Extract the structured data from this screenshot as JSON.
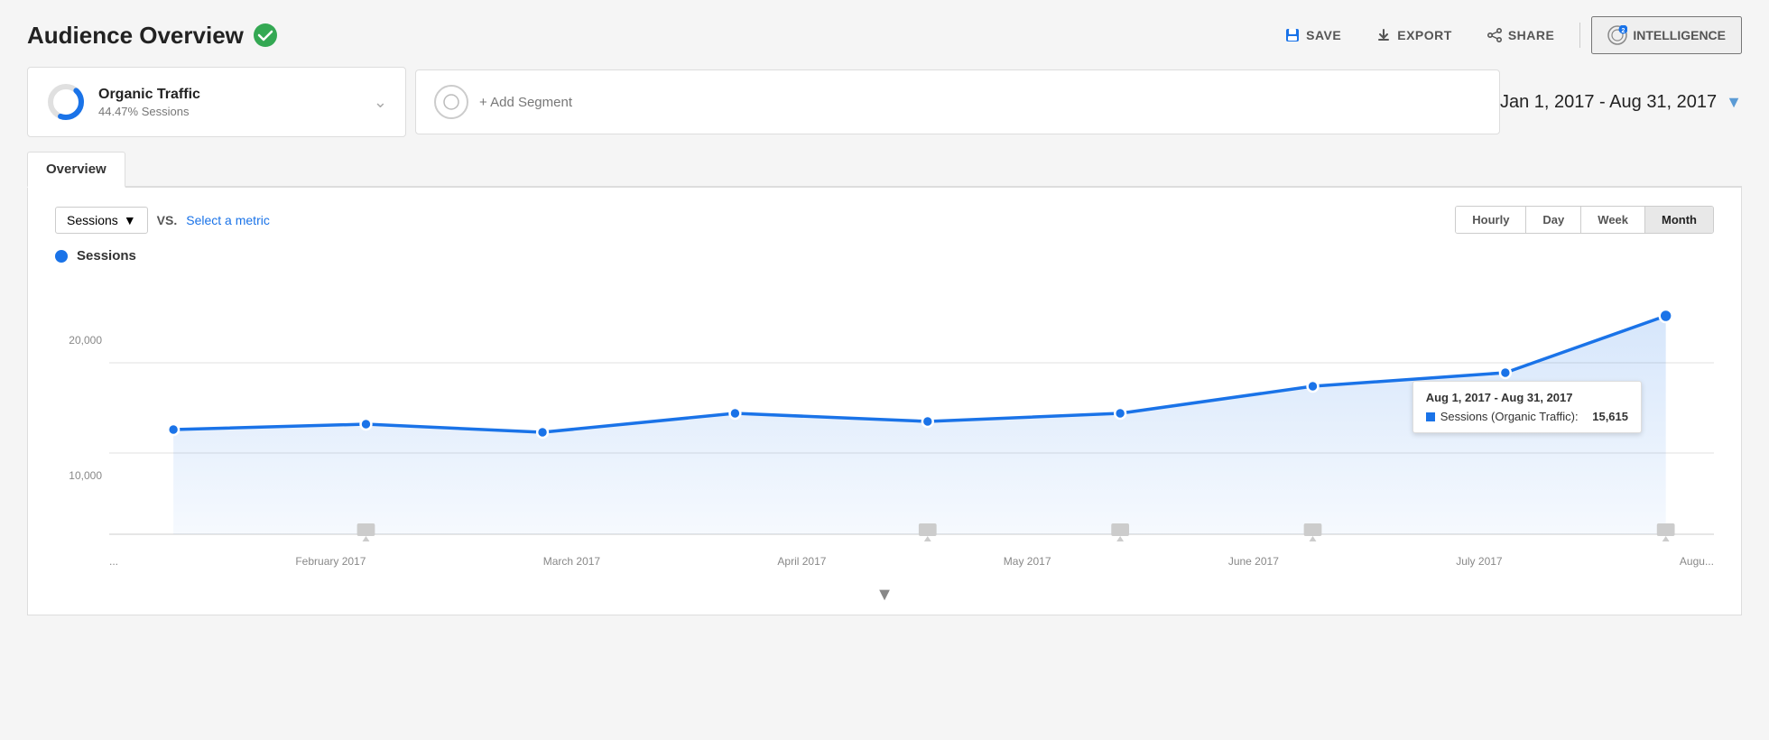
{
  "header": {
    "title": "Audience Overview",
    "actions": {
      "save": "SAVE",
      "export": "EXPORT",
      "share": "SHARE",
      "intelligence": "INTELLIGENCE",
      "intelligence_badge": "2"
    }
  },
  "segments": {
    "organic": {
      "name": "Organic Traffic",
      "pct": "44.47% Sessions"
    },
    "add": "+ Add Segment"
  },
  "date_range": "Jan 1, 2017 - Aug 31, 2017",
  "tabs": [
    "Overview"
  ],
  "chart": {
    "metric_btn": "Sessions",
    "vs_label": "VS.",
    "select_metric": "Select a metric",
    "time_buttons": [
      "Hourly",
      "Day",
      "Week",
      "Month"
    ],
    "active_time": "Month",
    "legend": "Sessions",
    "y_labels": [
      "20,000",
      "",
      "10,000",
      ""
    ],
    "x_labels": [
      "...",
      "February 2017",
      "March 2017",
      "April 2017",
      "May 2017",
      "June 2017",
      "July 2017",
      "Augu..."
    ],
    "data_points": [
      {
        "x": 0.04,
        "y": 0.58
      },
      {
        "x": 0.16,
        "y": 0.56
      },
      {
        "x": 0.27,
        "y": 0.59
      },
      {
        "x": 0.39,
        "y": 0.52
      },
      {
        "x": 0.51,
        "y": 0.55
      },
      {
        "x": 0.63,
        "y": 0.52
      },
      {
        "x": 0.75,
        "y": 0.42
      },
      {
        "x": 0.87,
        "y": 0.37
      },
      {
        "x": 0.97,
        "y": 0.16
      }
    ],
    "tooltip": {
      "date": "Aug 1, 2017 - Aug 31, 2017",
      "label": "Sessions (Organic Traffic):",
      "value": "15,615"
    }
  },
  "colors": {
    "blue": "#1a73e8",
    "green": "#34a853",
    "active_tab": "#e8e8e8"
  }
}
